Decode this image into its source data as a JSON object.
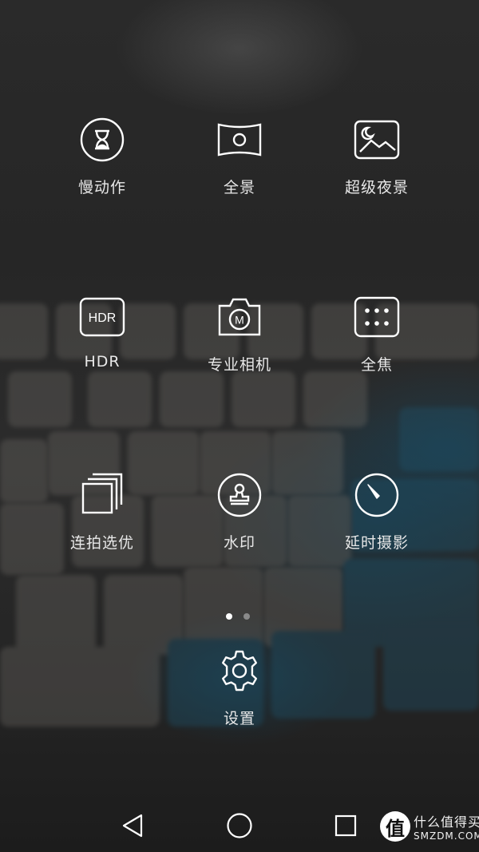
{
  "modes": [
    {
      "id": "slow-motion",
      "label": "慢动作",
      "icon": "hourglass-icon"
    },
    {
      "id": "panorama",
      "label": "全景",
      "icon": "panorama-icon"
    },
    {
      "id": "super-night",
      "label": "超级夜景",
      "icon": "night-landscape-icon"
    },
    {
      "id": "hdr",
      "label": "HDR",
      "icon": "hdr-icon",
      "icon_text": "HDR"
    },
    {
      "id": "pro-camera",
      "label": "专业相机",
      "icon": "pro-camera-icon",
      "icon_text": "M"
    },
    {
      "id": "all-focus",
      "label": "全焦",
      "icon": "all-focus-icon"
    },
    {
      "id": "burst",
      "label": "连拍选优",
      "icon": "burst-icon"
    },
    {
      "id": "watermark",
      "label": "水印",
      "icon": "stamp-icon"
    },
    {
      "id": "timelapse",
      "label": "延时摄影",
      "icon": "timelapse-icon"
    },
    {
      "id": "settings",
      "label": "设置",
      "icon": "gear-icon"
    }
  ],
  "pager": {
    "total": 2,
    "current": 1
  },
  "navbar": {
    "buttons": [
      "back-icon",
      "home-icon",
      "recents-icon"
    ]
  },
  "watermark": {
    "glyph": "值",
    "text_cn": "什么值得买",
    "text_en": "SMZDM.COM"
  },
  "colors": {
    "icon_stroke": "#ffffff",
    "label": "#e8e8e8"
  }
}
